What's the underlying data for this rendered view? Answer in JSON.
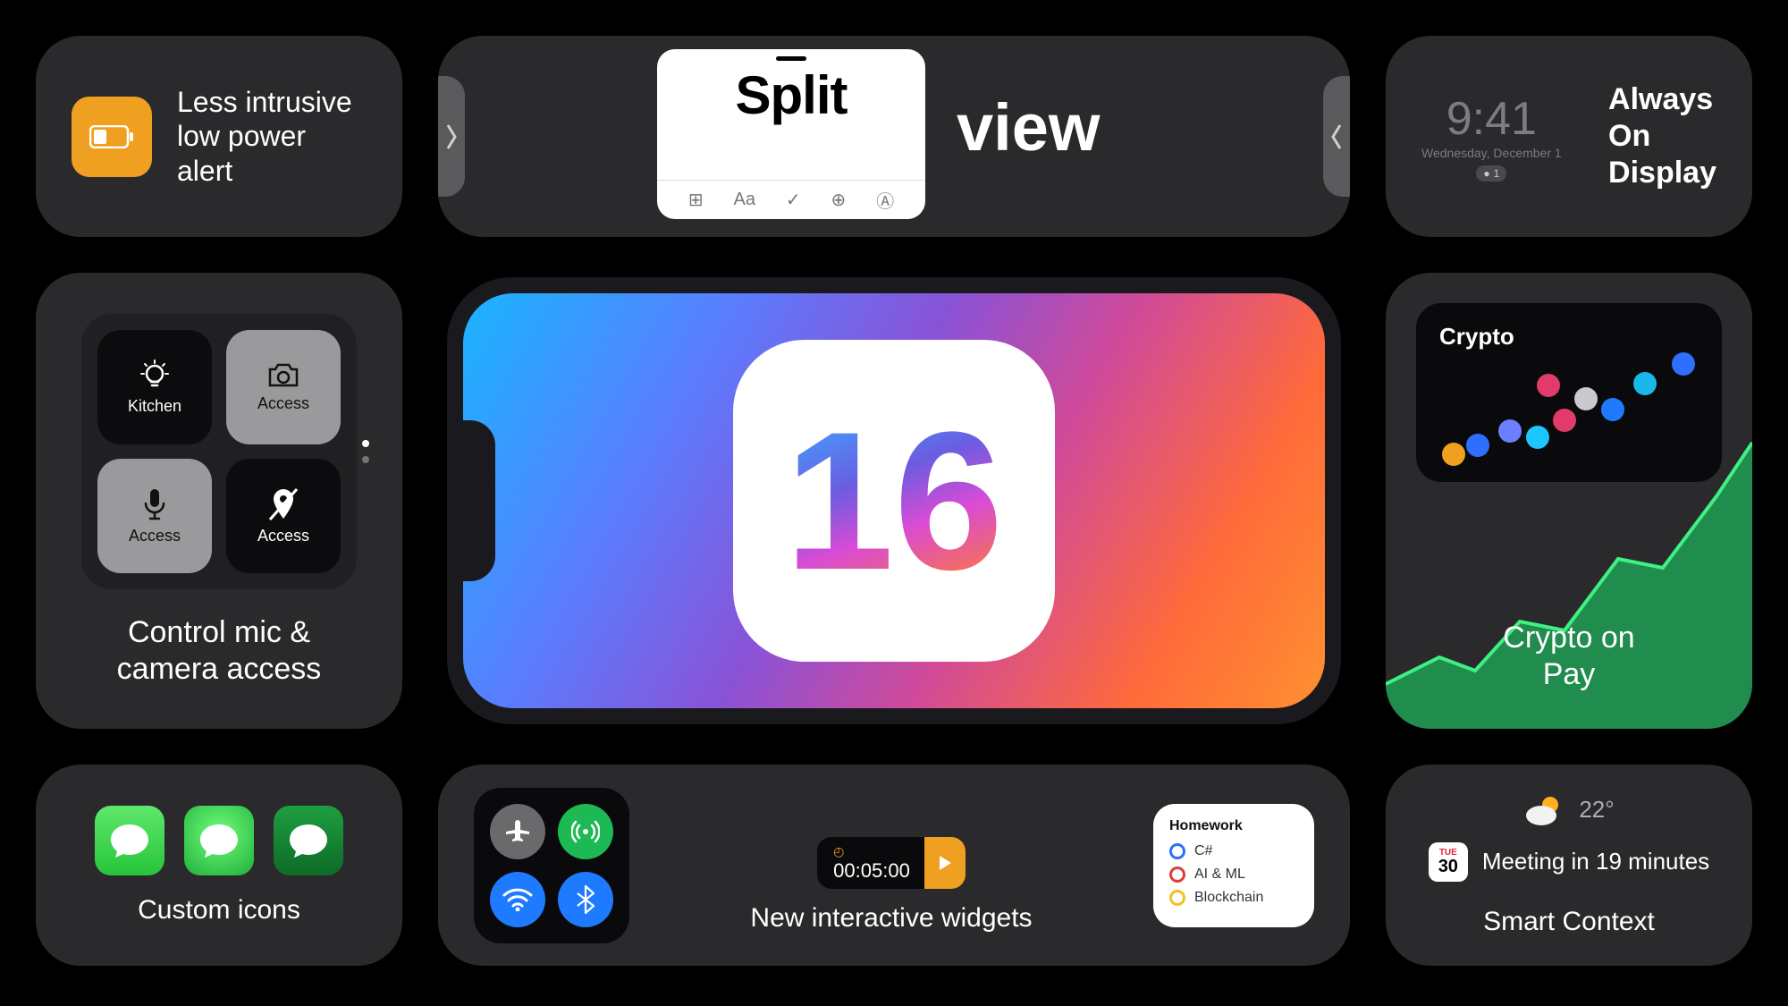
{
  "lowPower": {
    "label": "Less intrusive\nlow power alert"
  },
  "splitView": {
    "word1": "Split",
    "word2": "view",
    "toolbar": [
      "⊞",
      "Aa",
      "✓",
      "⊕",
      "Ⓐ"
    ]
  },
  "aod": {
    "time": "9:41",
    "date": "Wednesday, December 1",
    "badge": "1",
    "label": "Always\nOn\nDisplay"
  },
  "access": {
    "tiles": [
      "Kitchen",
      "Access",
      "Access",
      "Access"
    ],
    "label": "Control mic &\ncamera access"
  },
  "center": {
    "number": "16"
  },
  "crypto": {
    "widgetTitle": "Crypto",
    "label": "Crypto on\n Pay"
  },
  "customIcons": {
    "label": "Custom icons"
  },
  "widgets": {
    "timer": "00:05:00",
    "label": "New interactive widgets",
    "homework": {
      "title": "Homework",
      "items": [
        "C#",
        "AI & ML",
        "Blockchain"
      ]
    }
  },
  "context": {
    "temp": "22°",
    "calDay": "30",
    "calMonth": "TUE",
    "meeting": "Meeting in 19 minutes",
    "label": "Smart Context"
  }
}
